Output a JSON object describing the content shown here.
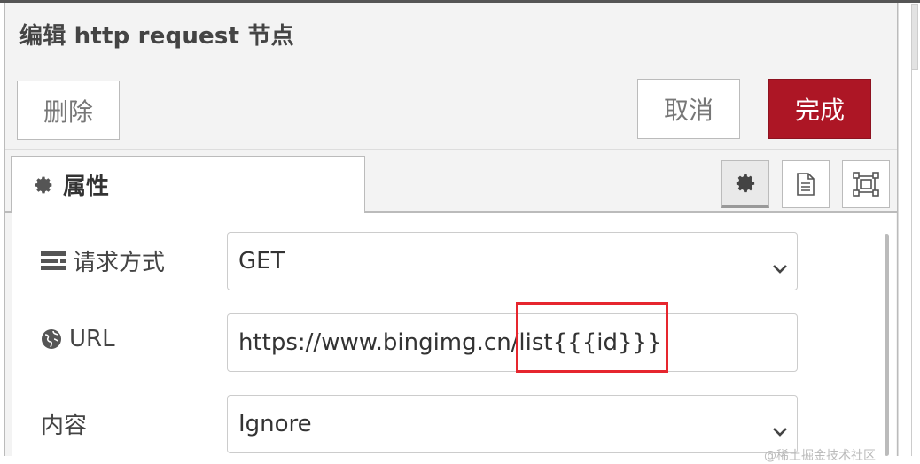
{
  "dialog": {
    "title": "编辑 http request 节点",
    "delete_label": "删除",
    "cancel_label": "取消",
    "done_label": "完成"
  },
  "tabs": {
    "properties_label": "属性",
    "icons": [
      "gear-icon",
      "description-icon",
      "appearance-icon"
    ]
  },
  "form": {
    "method_label": "请求方式",
    "method_value": "GET",
    "url_label": "URL",
    "url_value": "https://www.bingimg.cn/list{{{id}}}",
    "payload_label": "内容",
    "payload_value": "Ignore"
  },
  "watermark": "@稀土掘金技术社区",
  "colors": {
    "primary": "#ad1625",
    "highlight_box": "#e6262e",
    "tray": "#f3f3f3"
  }
}
